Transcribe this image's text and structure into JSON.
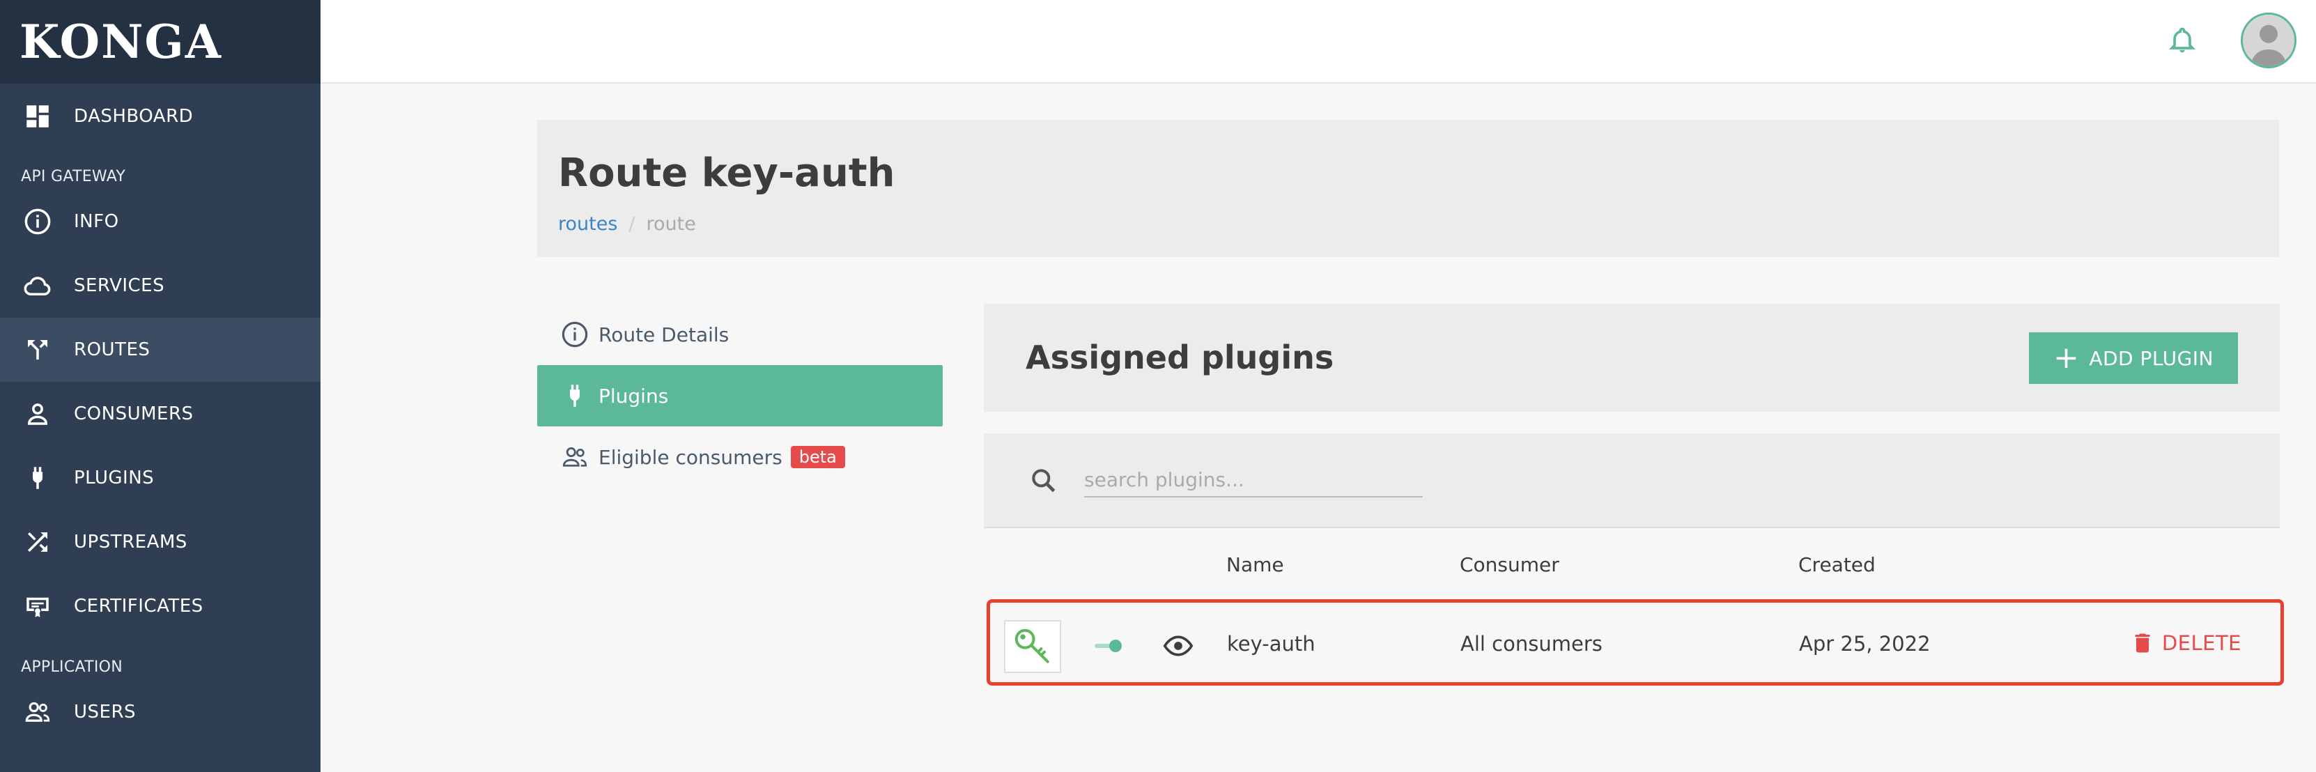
{
  "app": {
    "logo": "KONGA"
  },
  "sidebar": {
    "items": [
      {
        "label": "DASHBOARD",
        "icon": "dashboard-icon"
      },
      {
        "section": "API GATEWAY"
      },
      {
        "label": "INFO",
        "icon": "info-icon"
      },
      {
        "label": "SERVICES",
        "icon": "cloud-icon"
      },
      {
        "label": "ROUTES",
        "icon": "routes-icon",
        "active": true
      },
      {
        "label": "CONSUMERS",
        "icon": "person-icon"
      },
      {
        "label": "PLUGINS",
        "icon": "plug-icon"
      },
      {
        "label": "UPSTREAMS",
        "icon": "shuffle-icon"
      },
      {
        "label": "CERTIFICATES",
        "icon": "certificate-icon"
      },
      {
        "section": "APPLICATION"
      },
      {
        "label": "USERS",
        "icon": "users-icon"
      }
    ]
  },
  "topbar": {
    "bell_icon": "bell-icon",
    "avatar_icon": "avatar-icon"
  },
  "header": {
    "title": "Route key-auth",
    "breadcrumb": {
      "link": "routes",
      "current": "route"
    }
  },
  "subnav": {
    "details": "Route Details",
    "plugins": "Plugins",
    "consumers": "Eligible consumers",
    "beta": "beta"
  },
  "panel": {
    "title": "Assigned plugins",
    "add_label": "ADD PLUGIN",
    "search_placeholder": "search plugins..."
  },
  "table": {
    "headers": {
      "name": "Name",
      "consumer": "Consumer",
      "created": "Created"
    },
    "rows": [
      {
        "name": "key-auth",
        "consumer": "All consumers",
        "created": "Apr 25, 2022",
        "delete": "DELETE",
        "enabled": true
      }
    ]
  },
  "colors": {
    "accent": "#5cb89a",
    "sidebar": "#2f3e52",
    "danger": "#e54b4b",
    "highlight": "#e5412d"
  }
}
